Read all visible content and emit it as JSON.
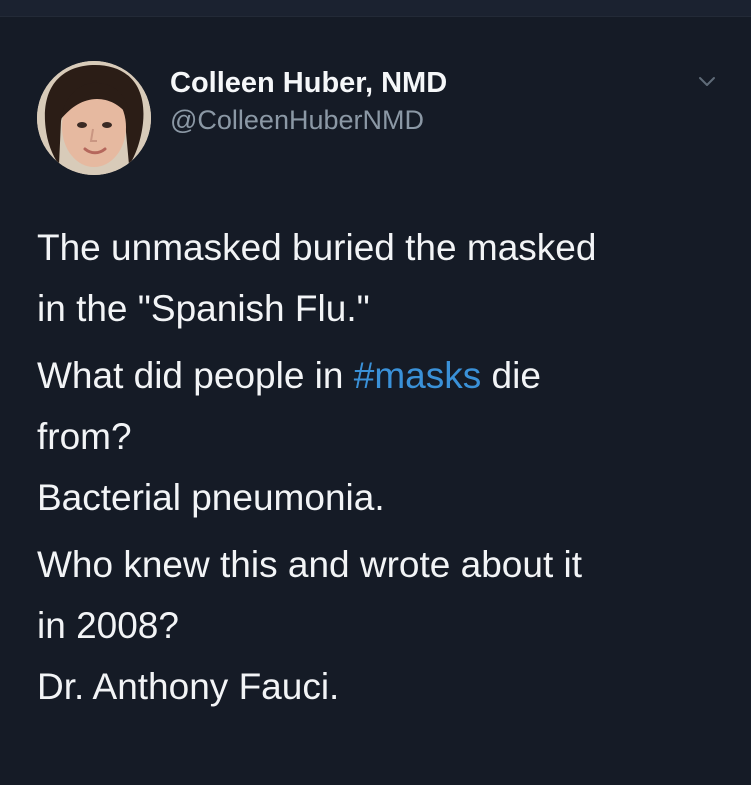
{
  "tweet": {
    "author": {
      "display_name": "Colleen Huber, NMD",
      "handle": "@ColleenHuberNMD"
    },
    "paragraphs": [
      {
        "lines": [
          "The unmasked buried the masked",
          "in the \"Spanish Flu.\""
        ]
      },
      {
        "line1_before": "What did people in ",
        "hashtag": "#masks",
        "line1_after": " die",
        "line2": "from?",
        "line3": "Bacterial pneumonia."
      },
      {
        "lines": [
          "Who knew this and wrote about it",
          "in 2008?",
          "Dr. Anthony Fauci."
        ]
      }
    ],
    "icons": {
      "menu": "chevron-down-icon",
      "avatar": "avatar"
    }
  },
  "colors": {
    "background": "#151b26",
    "text": "#f2f4f6",
    "secondary_text": "#8b98a5",
    "link": "#3a91d8"
  }
}
